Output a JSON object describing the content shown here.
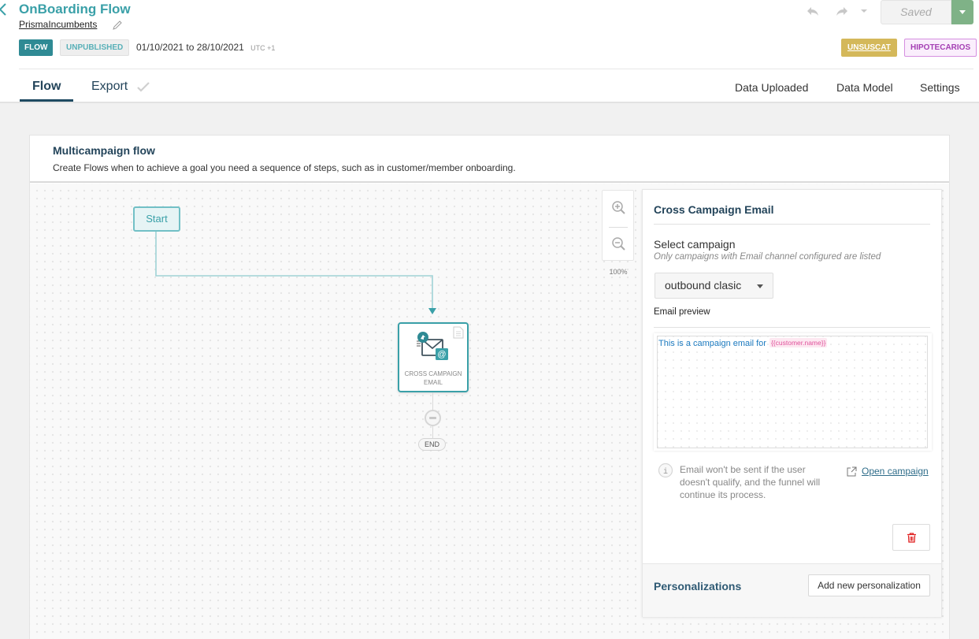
{
  "header": {
    "title": "OnBoarding Flow",
    "subtitle": "PrismaIncumbents",
    "type_badge": "FLOW",
    "status_badge": "UNPUBLISHED",
    "date_start": "01/10/2021",
    "date_sep": "to",
    "date_end": "28/10/2021",
    "timezone": "UTC +1",
    "saved_label": "Saved",
    "tags": [
      {
        "label": "UNSUSCAT",
        "color": "#d4b85a"
      },
      {
        "label": "HIPOTECARIOS",
        "color": "#a43fb3"
      }
    ]
  },
  "tabs": {
    "left": [
      {
        "label": "Flow",
        "active": true
      },
      {
        "label": "Export",
        "active": false
      }
    ],
    "right": [
      {
        "label": "Data Uploaded"
      },
      {
        "label": "Data Model"
      },
      {
        "label": "Settings"
      }
    ]
  },
  "card": {
    "title": "Multicampaign flow",
    "description": "Create Flows when to achieve a goal you need a sequence of steps, such as in customer/member onboarding."
  },
  "canvas": {
    "start_label": "Start",
    "node": {
      "label": "CROSS CAMPAIGN EMAIL",
      "icon": "cross-campaign-email-icon"
    },
    "end_label": "END",
    "zoom_level": "100%"
  },
  "panel": {
    "title": "Cross Campaign Email",
    "select_label": "Select campaign",
    "select_hint": "Only campaigns with Email channel configured are listed",
    "selected_campaign": "outbound clasic",
    "preview_label": "Email preview",
    "preview_text": "This is a campaign email for",
    "preview_variable": "{{customer.name}}",
    "info_text": "Email won't be sent if the user doesn't qualify, and the funnel will continue its process.",
    "open_campaign_label": "Open campaign",
    "personalizations_title": "Personalizations",
    "add_personalization_label": "Add new personalization"
  },
  "colors": {
    "accent": "#3aa0a8",
    "navy": "#23445a",
    "saved_green": "#7fb287",
    "danger": "#e02020"
  }
}
